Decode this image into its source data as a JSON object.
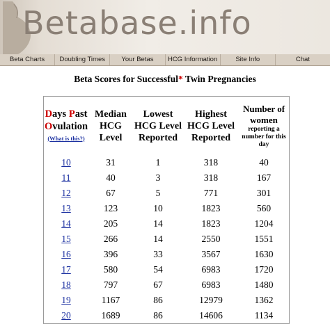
{
  "site": {
    "logo_text": "Betabase.info"
  },
  "nav": [
    "Beta Charts",
    "Doubling Times",
    "Your Betas",
    "HCG Information",
    "Site Info",
    "Chat"
  ],
  "title": {
    "before": "Beta Scores for Successful",
    "star": "*",
    "after": " Twin Pregnancies"
  },
  "table": {
    "dpo_header": {
      "d": "D",
      "ays": "ays ",
      "p": "P",
      "ast": "ast",
      "o": "O",
      "vulation": "vulation",
      "what_is_this": "(What is this?)"
    },
    "col_median": "Median HCG Level",
    "col_lowest": "Lowest HCG Level Reported",
    "col_highest": "Highest HCG Level Reported",
    "col_count_main": "Number of women",
    "col_count_sub": "reporting a number for this day",
    "rows": [
      {
        "dpo": "10",
        "median": "31",
        "lowest": "1",
        "highest": "318",
        "count": "40"
      },
      {
        "dpo": "11",
        "median": "40",
        "lowest": "3",
        "highest": "318",
        "count": "167"
      },
      {
        "dpo": "12",
        "median": "67",
        "lowest": "5",
        "highest": "771",
        "count": "301"
      },
      {
        "dpo": "13",
        "median": "123",
        "lowest": "10",
        "highest": "1823",
        "count": "560"
      },
      {
        "dpo": "14",
        "median": "205",
        "lowest": "14",
        "highest": "1823",
        "count": "1204"
      },
      {
        "dpo": "15",
        "median": "266",
        "lowest": "14",
        "highest": "2550",
        "count": "1551"
      },
      {
        "dpo": "16",
        "median": "396",
        "lowest": "33",
        "highest": "3567",
        "count": "1630"
      },
      {
        "dpo": "17",
        "median": "580",
        "lowest": "54",
        "highest": "6983",
        "count": "1720"
      },
      {
        "dpo": "18",
        "median": "797",
        "lowest": "67",
        "highest": "6983",
        "count": "1480"
      },
      {
        "dpo": "19",
        "median": "1167",
        "lowest": "86",
        "highest": "12979",
        "count": "1362"
      },
      {
        "dpo": "20",
        "median": "1689",
        "lowest": "86",
        "highest": "14606",
        "count": "1134"
      }
    ]
  }
}
